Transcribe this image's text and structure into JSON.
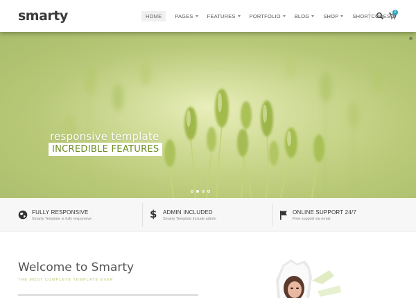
{
  "header": {
    "logo": "smarty",
    "nav": [
      {
        "label": "HOME",
        "active": true,
        "caret": false
      },
      {
        "label": "PAGES",
        "active": false,
        "caret": true
      },
      {
        "label": "FEATURES",
        "active": false,
        "caret": true
      },
      {
        "label": "PORTFOLIO",
        "active": false,
        "caret": true
      },
      {
        "label": "BLOG",
        "active": false,
        "caret": true
      },
      {
        "label": "SHOP",
        "active": false,
        "caret": true
      },
      {
        "label": "SHORTCODES",
        "active": false,
        "caret": true
      }
    ],
    "cart_count": "0",
    "icons": [
      "search-icon",
      "cart-icon"
    ]
  },
  "hero": {
    "subtitle": "responsive template",
    "title": "INCREDIBLE FEATURES",
    "slides": 4,
    "active_slide": 1
  },
  "features": [
    {
      "icon": "globe-icon",
      "title": "FULLY RESPONSIVE",
      "desc": "Smarty Template is fully responsive"
    },
    {
      "icon": "dollar-icon",
      "title": "ADMIN INCLUDED",
      "desc": "Smarty Template include admin"
    },
    {
      "icon": "flag-icon",
      "title": "ONLINE SUPPORT 24/7",
      "desc": "Free support via email"
    }
  ],
  "welcome": {
    "title": "Welcome to Smarty",
    "subtitle": "THE MOST COMPLETE TEMPLATE EVER"
  },
  "colors": {
    "accent": "#6a8b1f",
    "badge": "#27a4b9",
    "hero_green": "#c9d78a"
  }
}
